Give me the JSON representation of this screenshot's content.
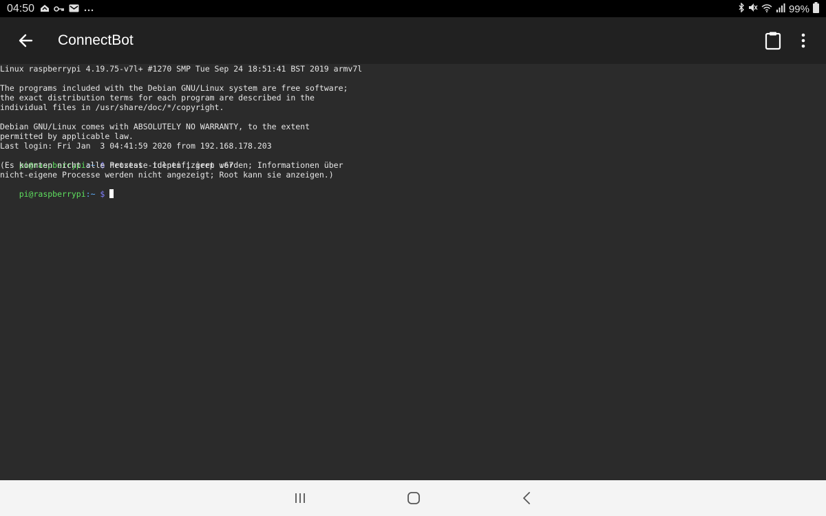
{
  "status_bar": {
    "time": "04:50",
    "battery": "99%",
    "left_icons": [
      "cloud-icon",
      "vpn-key-icon",
      "mail-icon",
      "more-notifications-icon"
    ],
    "right_icons": [
      "bluetooth-icon",
      "mute-icon",
      "wifi-icon",
      "signal-icon",
      "battery-icon"
    ]
  },
  "app_bar": {
    "title": "ConnectBot",
    "back_icon": "arrow-back-icon",
    "paste_icon": "clipboard-icon",
    "more_icon": "more-vert-icon"
  },
  "terminal": {
    "lines": [
      "Linux raspberrypi 4.19.75-v7l+ #1270 SMP Tue Sep 24 18:51:41 BST 2019 armv7l",
      "",
      "The programs included with the Debian GNU/Linux system are free software;",
      "the exact distribution terms for each program are described in the",
      "individual files in /usr/share/doc/*/copyright.",
      "",
      "Debian GNU/Linux comes with ABSOLUTELY NO WARRANTY, to the extent",
      "permitted by applicable law.",
      "Last login: Fri Jan  3 04:41:59 2020 from 192.168.178.203"
    ],
    "prompt_user": "pi@raspberrypi",
    "prompt_sep": ":~",
    "prompt_dollar": " $",
    "command": " netstat -tulpen | grep :67",
    "output_lines": [
      "(Es konnten nicht alle Prozesse identifiziert werden; Informationen über",
      "nicht-eigene Processe werden nicht angezeigt; Root kann sie anzeigen.)"
    ]
  },
  "nav_bar": {
    "recents_icon": "recents-icon",
    "home_icon": "home-icon",
    "back_icon": "nav-back-icon"
  },
  "colors": {
    "terminal_bg": "#2b2b2b",
    "app_bar_bg": "#212121",
    "prompt_user": "#5fe05f",
    "prompt_dollar": "#8080ff"
  }
}
